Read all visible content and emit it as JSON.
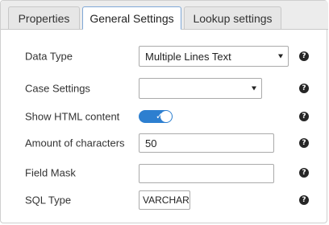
{
  "tabs": [
    {
      "label": "Properties",
      "active": false
    },
    {
      "label": "General Settings",
      "active": true
    },
    {
      "label": "Lookup settings",
      "active": false
    }
  ],
  "fields": {
    "data_type": {
      "label": "Data Type",
      "value": "Multiple Lines Text"
    },
    "case_settings": {
      "label": "Case Settings",
      "value": ""
    },
    "show_html": {
      "label": "Show HTML content",
      "checked": true
    },
    "amount_chars": {
      "label": "Amount of characters",
      "value": "50"
    },
    "field_mask": {
      "label": "Field Mask",
      "value": ""
    },
    "sql_type": {
      "label": "SQL Type",
      "value": "VARCHAR"
    }
  },
  "help_icon": "question-circle",
  "colors": {
    "toggle_on": "#2d7fd0",
    "active_tab_border": "#7fa7d6"
  }
}
